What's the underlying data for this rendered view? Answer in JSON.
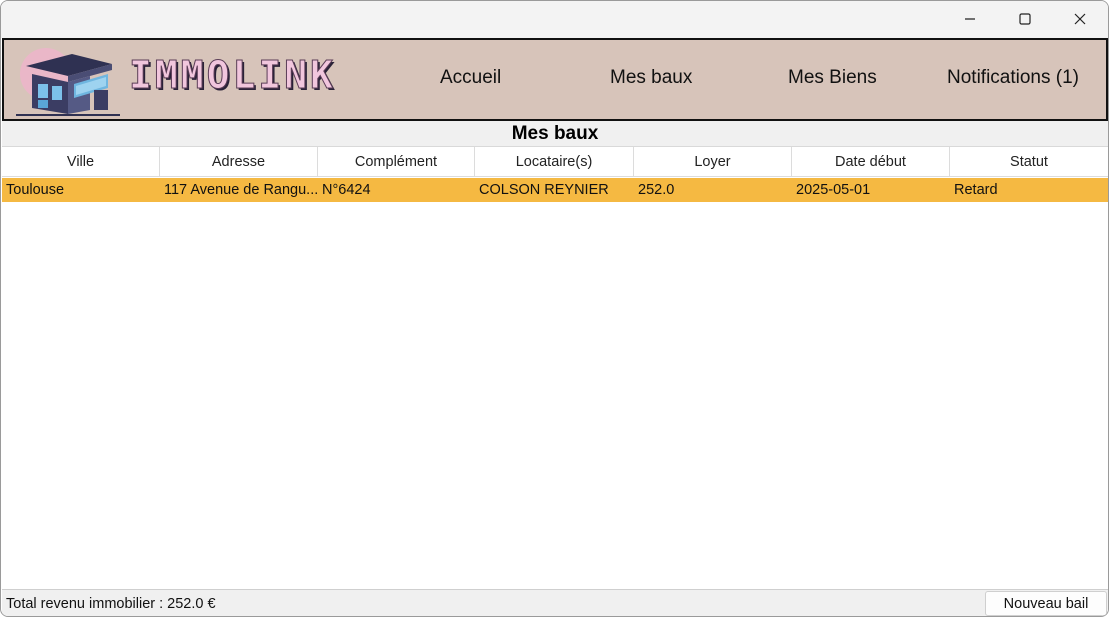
{
  "header": {
    "brand": "IMMOLINK",
    "brand_color": "#f1c6dd",
    "header_bg": "#d7c4ba",
    "nav": [
      {
        "label": "Accueil"
      },
      {
        "label": "Mes baux"
      },
      {
        "label": "Mes Biens"
      },
      {
        "label": "Notifications (1)"
      }
    ]
  },
  "main": {
    "title": "Mes baux",
    "columns": [
      "Ville",
      "Adresse",
      "Complément",
      "Locataire(s)",
      "Loyer",
      "Date début",
      "Statut"
    ],
    "rows": [
      {
        "ville": "Toulouse",
        "adresse": "117 Avenue de Rangu...",
        "complement": "N°6424",
        "locataires": "COLSON REYNIER",
        "loyer": "252.0",
        "date_debut": "2025-05-01",
        "statut": "Retard",
        "highlight_color": "#f5b942"
      }
    ]
  },
  "footer": {
    "total": "Total revenu immobilier : 252.0 €",
    "new_button": "Nouveau bail"
  },
  "icons": {
    "minimize": "minimize-icon",
    "maximize": "maximize-icon",
    "close": "close-icon",
    "logo": "house-logo-icon"
  }
}
